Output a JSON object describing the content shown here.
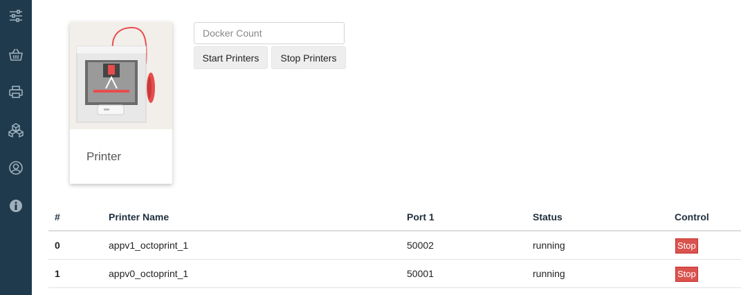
{
  "sidebar": {
    "items": [
      {
        "icon": "sliders-icon"
      },
      {
        "icon": "basket-icon"
      },
      {
        "icon": "printer-icon"
      },
      {
        "icon": "cubes-icon"
      },
      {
        "icon": "user-circle-icon"
      },
      {
        "icon": "info-circle-icon"
      }
    ],
    "color": "#1f3a4d"
  },
  "card": {
    "title": "Printer"
  },
  "docker": {
    "placeholder": "Docker Count",
    "value": ""
  },
  "buttons": {
    "start": "Start Printers",
    "stop": "Stop Printers"
  },
  "table": {
    "headers": [
      "#",
      "Printer Name",
      "Port 1",
      "Status",
      "Control"
    ],
    "rows": [
      {
        "id": "0",
        "name": "appv1_octoprint_1",
        "port": "50002",
        "status": "running",
        "control": "Stop"
      },
      {
        "id": "1",
        "name": "appv0_octoprint_1",
        "port": "50001",
        "status": "running",
        "control": "Stop"
      }
    ]
  },
  "colors": {
    "stop": "#d9534f",
    "accent": "#e84c4c"
  }
}
